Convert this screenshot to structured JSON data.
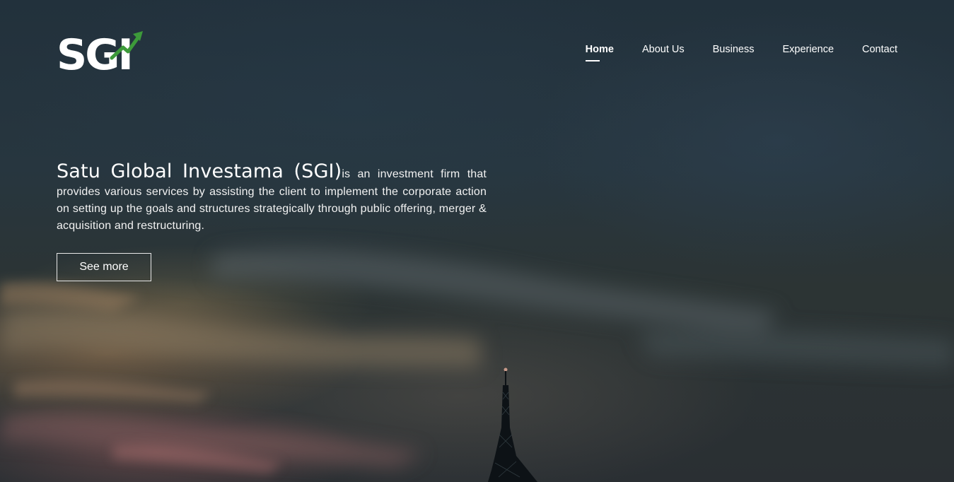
{
  "logo": {
    "text": "SGI",
    "accent_color": "#3d9a3a"
  },
  "nav": {
    "items": [
      {
        "label": "Home",
        "active": true
      },
      {
        "label": "About Us",
        "active": false
      },
      {
        "label": "Business",
        "active": false
      },
      {
        "label": "Experience",
        "active": false
      },
      {
        "label": "Contact",
        "active": false
      }
    ]
  },
  "hero": {
    "brand": "Satu Global Investama (SGI)",
    "description": "is an investment firm that provides various services by assisting the client to implement the corporate action on setting up the goals and structures strategically through public offering, merger & acquisition and restructuring.",
    "cta_label": "See more"
  },
  "colors": {
    "text": "#ffffff",
    "background": "#22313c"
  }
}
